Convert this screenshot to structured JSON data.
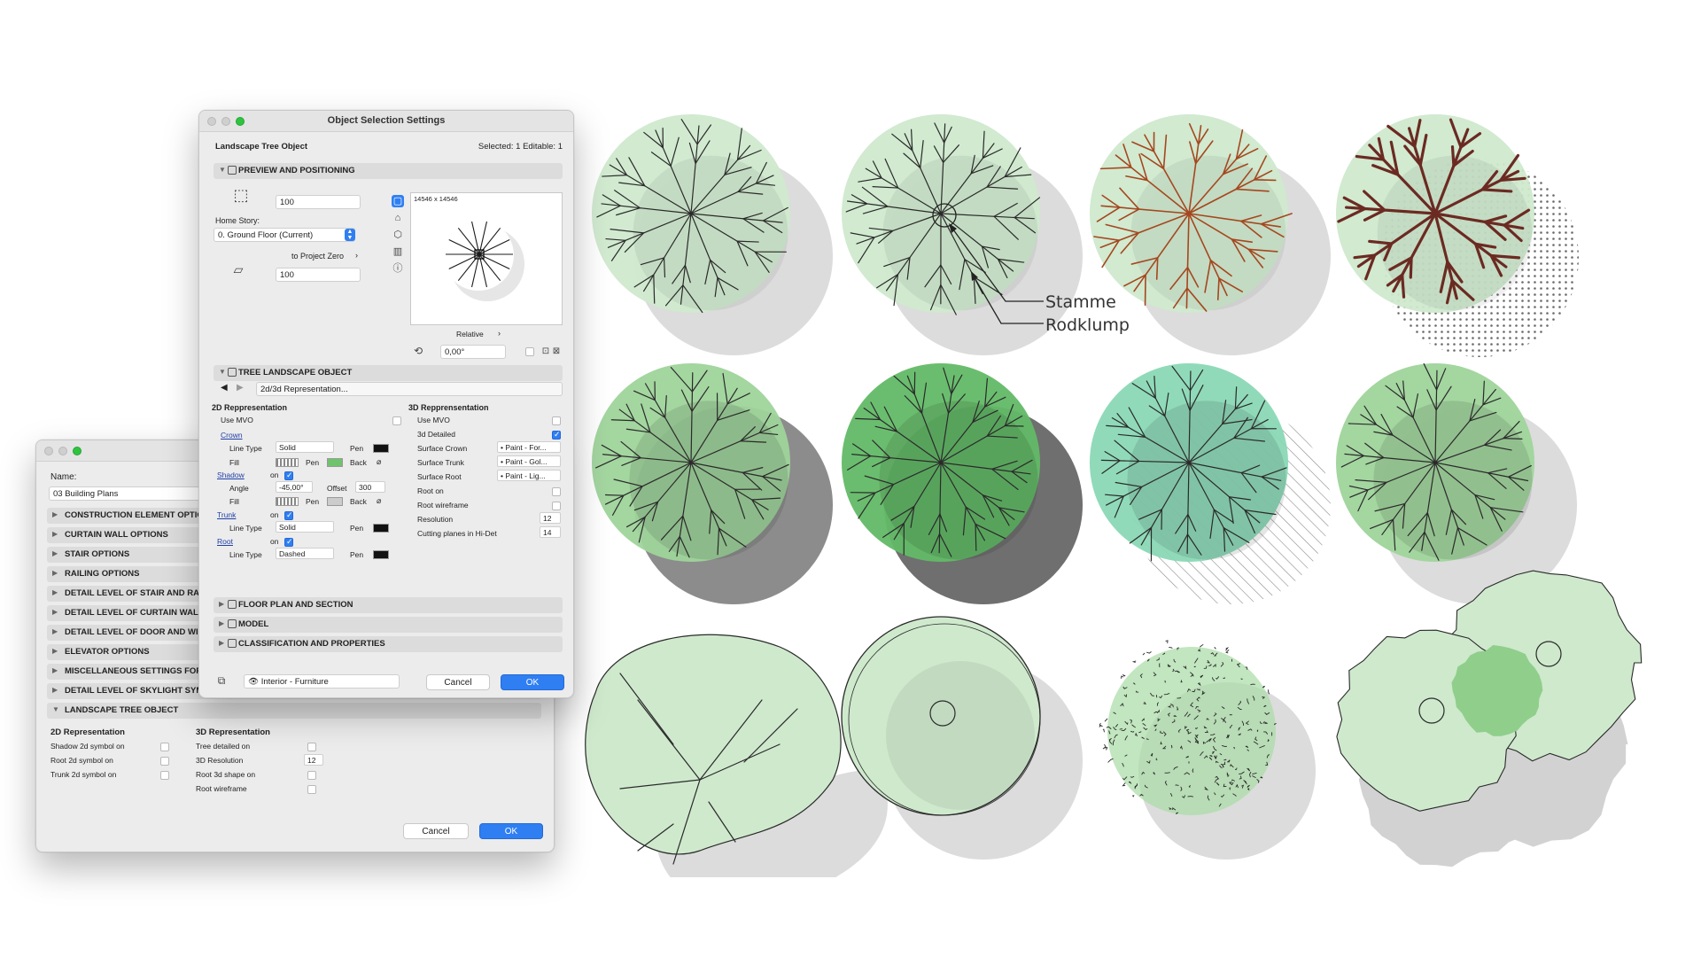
{
  "back_window": {
    "name_label": "Name:",
    "name_value": "03 Building Plans",
    "sections": [
      "CONSTRUCTION ELEMENT OPTIONS",
      "CURTAIN WALL OPTIONS",
      "STAIR OPTIONS",
      "RAILING OPTIONS",
      "DETAIL LEVEL OF STAIR AND RAILING",
      "DETAIL LEVEL OF CURTAIN WALL",
      "DETAIL LEVEL OF DOOR AND WINDOW",
      "ELEVATOR OPTIONS",
      "MISCELLANEOUS SETTINGS FOR",
      "DETAIL LEVEL OF SKYLIGHT SYMBOL",
      "LANDSCAPE TREE OBJECT"
    ],
    "rep2d_title": "2D Representation",
    "rep3d_title": "3D Representation",
    "rep2d_items": [
      "Shadow 2d symbol on",
      "Root 2d symbol on",
      "Trunk 2d symbol on"
    ],
    "rep3d_items": [
      "Tree detailed on",
      "3D Resolution",
      "Root 3d shape on",
      "Root wireframe"
    ],
    "resolution_value": "12",
    "cancel": "Cancel",
    "ok": "OK"
  },
  "main_window": {
    "title": "Object Selection Settings",
    "object_name": "Landscape Tree Object",
    "selected": "Selected: 1 Editable: 1",
    "preview_section": "PREVIEW AND POSITIONING",
    "height_value": "100",
    "home_story_label": "Home Story:",
    "home_story_value": "0. Ground Floor (Current)",
    "to_project_zero": "to Project Zero",
    "elevation_value": "100",
    "preview_size": "14546 x 14546",
    "relative": "Relative",
    "angle_value": "0,00°",
    "tree_section": "TREE LANDSCAPE OBJECT",
    "rep_nav": "2d/3d Representation...",
    "rep2d": {
      "title": "2D Reppresentation",
      "use_mvo": "Use MVO",
      "crown": "Crown",
      "line_type": "Line Type",
      "solid": "Solid",
      "pen": "Pen",
      "fill": "Fill",
      "back": "Back",
      "shadow": "Shadow",
      "on": "on",
      "angle": "Angle",
      "angle_value": "-45,00°",
      "offset": "Offset",
      "offset_value": "300",
      "trunk": "Trunk",
      "root": "Root",
      "dashed": "Dashed"
    },
    "rep3d": {
      "title": "3D Repprensentation",
      "use_mvo": "Use MVO",
      "detailed": "3d Detailed",
      "surface_crown": "Surface Crown",
      "surface_crown_value": "• Paint - For...",
      "surface_trunk": "Surface Trunk",
      "surface_trunk_value": "• Paint - Gol...",
      "surface_root": "Surface Root",
      "surface_root_value": "• Paint - Lig...",
      "root_on": "Root on",
      "root_wireframe": "Root wireframe",
      "resolution": "Resolution",
      "resolution_value": "12",
      "cutting_planes": "Cutting planes in Hi-Det",
      "cutting_planes_value": "14"
    },
    "floor_plan_section": "FLOOR PLAN AND SECTION",
    "model_section": "MODEL",
    "classification_section": "CLASSIFICATION AND PROPERTIES",
    "layer_value": "Interior - Furniture",
    "cancel": "Cancel",
    "ok": "OK"
  },
  "annotations": {
    "stamme": "Stamme",
    "rodklump": "Rodklump"
  },
  "colors": {
    "light_green": "#cfe9cd",
    "mid_green": "#9fd49b",
    "dark_green": "#62b966",
    "teal_green": "#8ad8b5",
    "shadow_grey": "#dadada",
    "branch_dark": "#2a2a2a",
    "branch_brown": "#a5471f",
    "branch_maroon": "#6b2a22",
    "ok_blue": "#2f7ff3"
  }
}
